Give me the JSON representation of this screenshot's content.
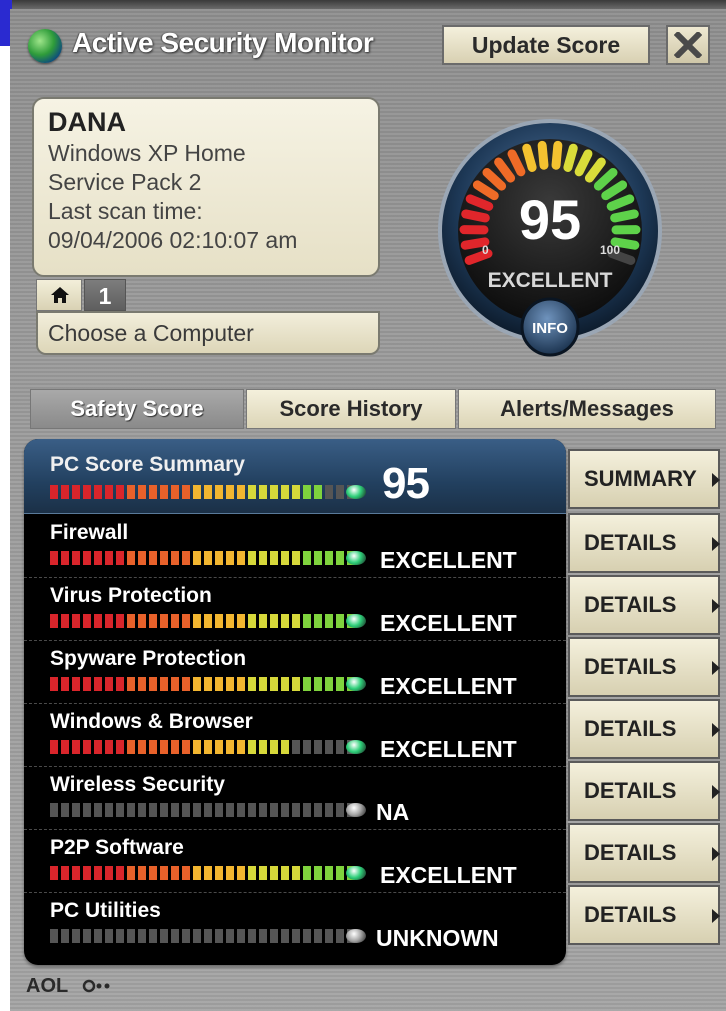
{
  "app": {
    "title": "Active Security Monitor",
    "update_label": "Update Score"
  },
  "computer": {
    "name": "DANA",
    "os": "Windows XP Home",
    "service_pack": "Service Pack 2",
    "scan_label": "Last scan time:",
    "scan_time": "09/04/2006 02:10:07 am",
    "tab_number": "1",
    "choose_label": "Choose a Computer"
  },
  "gauge": {
    "score": "95",
    "min": "0",
    "max": "100",
    "rating": "EXCELLENT",
    "info_label": "INFO",
    "score_value": 95
  },
  "tabs": [
    {
      "label": "Safety Score",
      "active": true
    },
    {
      "label": "Score History",
      "active": false
    },
    {
      "label": "Alerts/Messages",
      "active": false
    }
  ],
  "summary": {
    "label": "PC Score Summary",
    "score": "95",
    "button": "SUMMARY",
    "level": 0.9
  },
  "categories": [
    {
      "label": "Firewall",
      "status": "EXCELLENT",
      "button": "DETAILS",
      "level": 1.0,
      "led": "green"
    },
    {
      "label": "Virus Protection",
      "status": "EXCELLENT",
      "button": "DETAILS",
      "level": 1.0,
      "led": "green"
    },
    {
      "label": "Spyware Protection",
      "status": "EXCELLENT",
      "button": "DETAILS",
      "level": 1.0,
      "led": "green"
    },
    {
      "label": "Windows & Browser",
      "status": "EXCELLENT",
      "button": "DETAILS",
      "level": 0.78,
      "led": "green"
    },
    {
      "label": "Wireless Security",
      "status": "NA",
      "button": "DETAILS",
      "level": 0,
      "led": "gray"
    },
    {
      "label": "P2P Software",
      "status": "EXCELLENT",
      "button": "DETAILS",
      "level": 1.0,
      "led": "green"
    },
    {
      "label": "PC Utilities",
      "status": "UNKNOWN",
      "button": "DETAILS",
      "level": 0,
      "led": "gray"
    }
  ],
  "footer": {
    "brand": "AOL"
  },
  "colors": {
    "led_green": "#2fd07a",
    "led_gray": "#a8a8a8",
    "summary_bg": "#22405f",
    "accent": "#2a2ad0"
  }
}
